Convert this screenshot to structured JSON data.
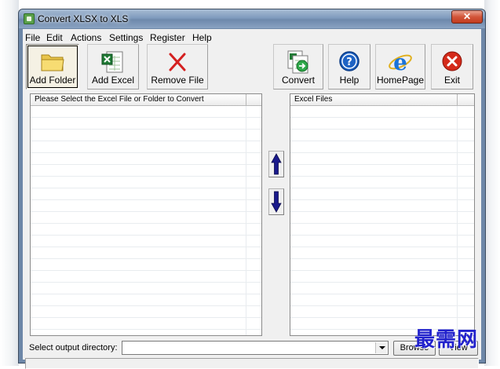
{
  "window": {
    "title": "Convert XLSX to XLS",
    "close_glyph": "✕"
  },
  "menu": [
    {
      "label": "File"
    },
    {
      "label": "Edit"
    },
    {
      "label": "Actions"
    },
    {
      "label": "Settings"
    },
    {
      "label": "Register"
    },
    {
      "label": "Help"
    }
  ],
  "toolbar": {
    "add_folder": {
      "label": "Add Folder",
      "icon": "folder-icon",
      "state": "pressed"
    },
    "add_excel": {
      "label": "Add Excel",
      "icon": "excel-file-icon"
    },
    "remove_file": {
      "label": "Remove File",
      "icon": "red-x-icon"
    },
    "convert": {
      "label": "Convert",
      "icon": "convert-icon"
    },
    "help": {
      "label": "Help",
      "icon": "help-icon"
    },
    "homepage": {
      "label": "HomePage",
      "icon": "internet-explorer-icon"
    },
    "exit": {
      "label": "Exit",
      "icon": "exit-icon"
    }
  },
  "source_list": {
    "header": "Please Select the Excel File or Folder to Convert",
    "rows": []
  },
  "target_list": {
    "header": "Excel Files",
    "rows": []
  },
  "move_buttons": {
    "up_icon": "arrow-up-icon",
    "down_icon": "arrow-down-icon"
  },
  "output": {
    "label": "Select  output directory:",
    "value": "",
    "browse_label": "Browse",
    "view_label": "View"
  },
  "watermark": "最需网",
  "colors": {
    "arrow": "#1a1a8c",
    "remove_x": "#d42020",
    "exit_red": "#d42a1a",
    "help_blue": "#1f63c4",
    "watermark": "#2222cc"
  }
}
